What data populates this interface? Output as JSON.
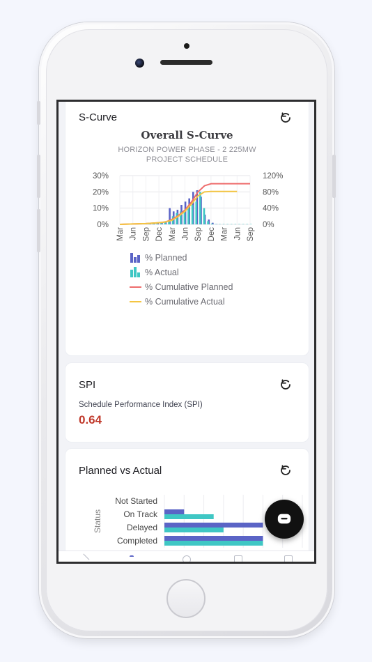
{
  "scurve": {
    "card_title": "S-Curve",
    "chart_title": "Overall S-Curve",
    "chart_subtitle_1": "HORIZON POWER PHASE - 2 225MW",
    "chart_subtitle_2": "PROJECT SCHEDULE",
    "legend": [
      "% Planned",
      "% Actual",
      "% Cumulative Planned",
      "% Cumulative Actual"
    ],
    "colors": {
      "planned": "#5b64c6",
      "actual": "#3fc7c4",
      "cum_planned": "#ee6c6c",
      "cum_actual": "#f4c542"
    }
  },
  "spi": {
    "card_title": "SPI",
    "label": "Schedule Performance Index (SPI)",
    "value": "0.64"
  },
  "pva": {
    "card_title": "Planned vs Actual",
    "axis_label": "Status"
  },
  "chart_data": [
    {
      "type": "bar",
      "title": "Overall S-Curve",
      "subtitle": "HORIZON POWER PHASE - 2 225MW PROJECT SCHEDULE",
      "categories": [
        "Mar",
        "Jun",
        "Sep",
        "Dec",
        "Mar",
        "Jun",
        "Sep",
        "Dec",
        "Mar",
        "Jun",
        "Sep"
      ],
      "ylim_left": [
        0,
        30
      ],
      "ylim_right": [
        0,
        120
      ],
      "yticks_left": [
        "0%",
        "10%",
        "20%",
        "30%"
      ],
      "yticks_right": [
        "0%",
        "40%",
        "80%",
        "120%"
      ],
      "grid": true,
      "legend_position": "bottom",
      "series": [
        {
          "name": "% Planned",
          "axis": "left",
          "x": [
            0.3,
            0.6,
            0.9,
            1.2,
            1.5,
            1.8,
            2.1,
            2.4,
            2.7,
            3.0,
            3.3,
            3.6,
            3.9,
            4.2,
            4.5,
            4.8,
            5.1,
            5.4,
            5.7,
            6.0,
            6.3,
            6.6,
            6.9,
            7.2,
            7.5
          ],
          "values": [
            0.1,
            0.1,
            0.2,
            0.2,
            0.3,
            0.4,
            0.4,
            0.5,
            0.6,
            0.8,
            1.0,
            2.0,
            10,
            8,
            9,
            12,
            14,
            16,
            20,
            21,
            17,
            6,
            3,
            1,
            0.2
          ]
        },
        {
          "name": "% Actual",
          "axis": "left",
          "x": [
            0.4,
            0.7,
            1.0,
            1.3,
            1.6,
            1.9,
            2.2,
            2.5,
            2.8,
            3.1,
            3.4,
            3.7,
            4.0,
            4.3,
            4.6,
            4.9,
            5.2,
            5.5,
            5.8,
            6.1,
            6.4,
            6.7,
            7.0,
            7.3,
            7.6,
            7.9,
            8.2,
            8.5,
            8.8,
            9.1,
            9.4,
            9.7,
            10.0
          ],
          "values": [
            0.1,
            0.1,
            0.2,
            0.3,
            0.3,
            0.3,
            0.5,
            0.5,
            0.6,
            0.7,
            1.0,
            1.5,
            5,
            7,
            8,
            9,
            10,
            12,
            14,
            20,
            10,
            2,
            0.5,
            0.2,
            0.2,
            0.2,
            0.2,
            0.2,
            0.2,
            0.2,
            0.2,
            0.2,
            0.2
          ]
        },
        {
          "name": "% Cumulative Planned",
          "axis": "right",
          "x": [
            0,
            1,
            2,
            3,
            3.5,
            4,
            4.5,
            5,
            5.5,
            6,
            6.5,
            7,
            8,
            9,
            10
          ],
          "values": [
            0,
            1,
            2,
            4,
            6,
            12,
            22,
            35,
            55,
            80,
            95,
            100,
            100,
            100,
            100
          ]
        },
        {
          "name": "% Cumulative Actual",
          "axis": "right",
          "x": [
            0,
            1,
            2,
            3,
            3.5,
            4,
            4.5,
            5,
            5.5,
            6,
            6.5,
            7,
            8,
            9
          ],
          "values": [
            0,
            1,
            2,
            4,
            6,
            10,
            20,
            32,
            50,
            70,
            80,
            81,
            81,
            81
          ]
        }
      ]
    },
    {
      "type": "bar",
      "orientation": "horizontal",
      "title": "Planned vs Actual",
      "ylabel": "Status",
      "categories": [
        "Not Started",
        "On Track",
        "Delayed",
        "Completed"
      ],
      "xlim": [
        0,
        14
      ],
      "series": [
        {
          "name": "Planned",
          "values": [
            0,
            2,
            10,
            10
          ]
        },
        {
          "name": "Actual",
          "values": [
            0,
            5,
            6,
            10
          ]
        }
      ]
    }
  ]
}
